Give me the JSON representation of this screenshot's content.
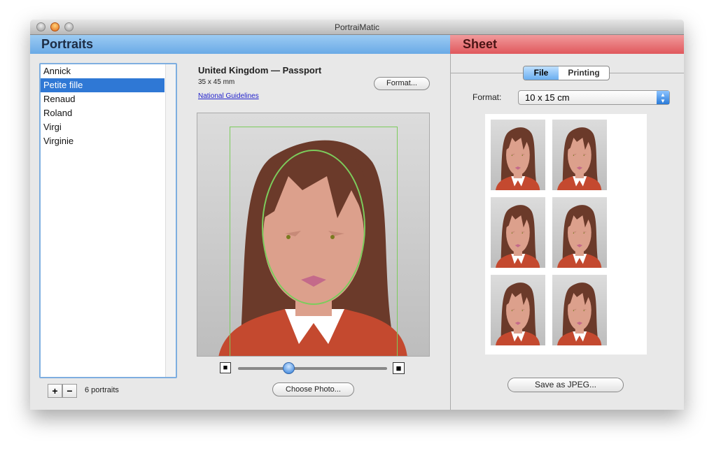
{
  "window": {
    "title": "PortraiMatic"
  },
  "portraits_panel": {
    "header": "Portraits",
    "list": [
      {
        "label": "Annick",
        "selected": false
      },
      {
        "label": "Petite fille",
        "selected": true
      },
      {
        "label": "Renaud",
        "selected": false
      },
      {
        "label": "Roland",
        "selected": false
      },
      {
        "label": "Virgi",
        "selected": false
      },
      {
        "label": "Virginie",
        "selected": false
      }
    ],
    "add_label": "+",
    "remove_label": "−",
    "count": "6 portraits",
    "format_title": "United Kingdom — Passport",
    "format_size": "35 x 45 mm",
    "guidelines_link": "National Guidelines",
    "format_button": "Format...",
    "zoom_slider": 0.34,
    "choose_photo_button": "Choose Photo..."
  },
  "sheet_panel": {
    "header": "Sheet",
    "tabs": [
      {
        "label": "File",
        "selected": true
      },
      {
        "label": "Printing",
        "selected": false
      }
    ],
    "format_label": "Format:",
    "format_value": "10 x 15 cm",
    "save_button": "Save as JPEG..."
  },
  "colors": {
    "portraits_header": "#7fb8ec",
    "sheet_header": "#e86a6e",
    "selection": "#2f78d5",
    "guide": "#7ccc5c",
    "shirt": "#c4492f",
    "hair": "#6b3a2a",
    "skin": "#dca08c"
  }
}
